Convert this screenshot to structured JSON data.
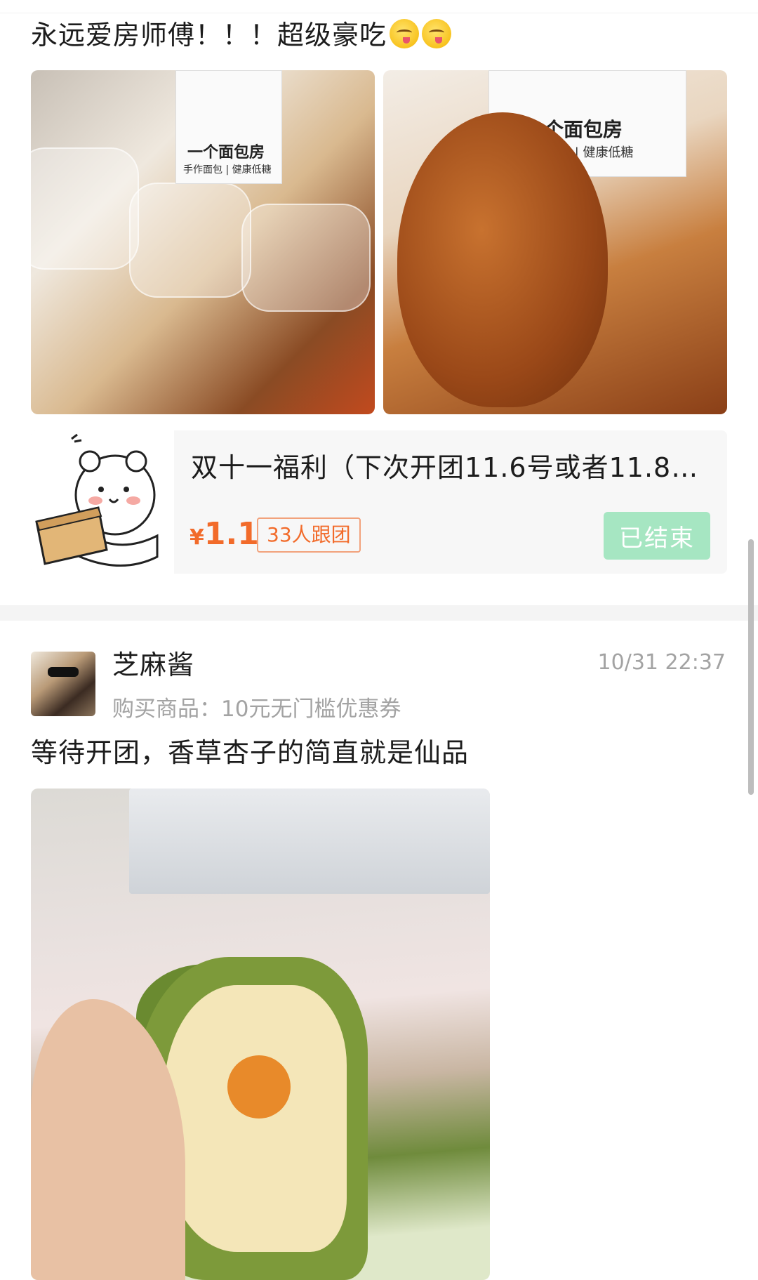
{
  "post1": {
    "text": "永远爱房师傅！！！超级豪吃",
    "emoji_count": 2,
    "emoji_icon": "yum-face-emoji",
    "photo_left_label": "一个面包房",
    "photo_left_sublabel": "手作面包 | 健康低糖",
    "photo_right_label": "一个面包房",
    "photo_right_sublabel": "手作面包 | 健康低糖"
  },
  "product_card": {
    "title": "双十一福利（下次开团11.6号或者11.8…",
    "price_symbol": "¥",
    "price_value": "1.1",
    "group_badge": "33人跟团",
    "status_button": "已结束",
    "thumb_icon": "bear-with-box-illustration",
    "price_color": "#f26b2a",
    "button_color": "#a6e6c2"
  },
  "post2": {
    "username": "芝麻酱",
    "timestamp": "10/31 22:37",
    "purchase_line": "购买商品：10元无门槛优惠券",
    "text": "等待开团，香草杏子的简直就是仙品"
  }
}
